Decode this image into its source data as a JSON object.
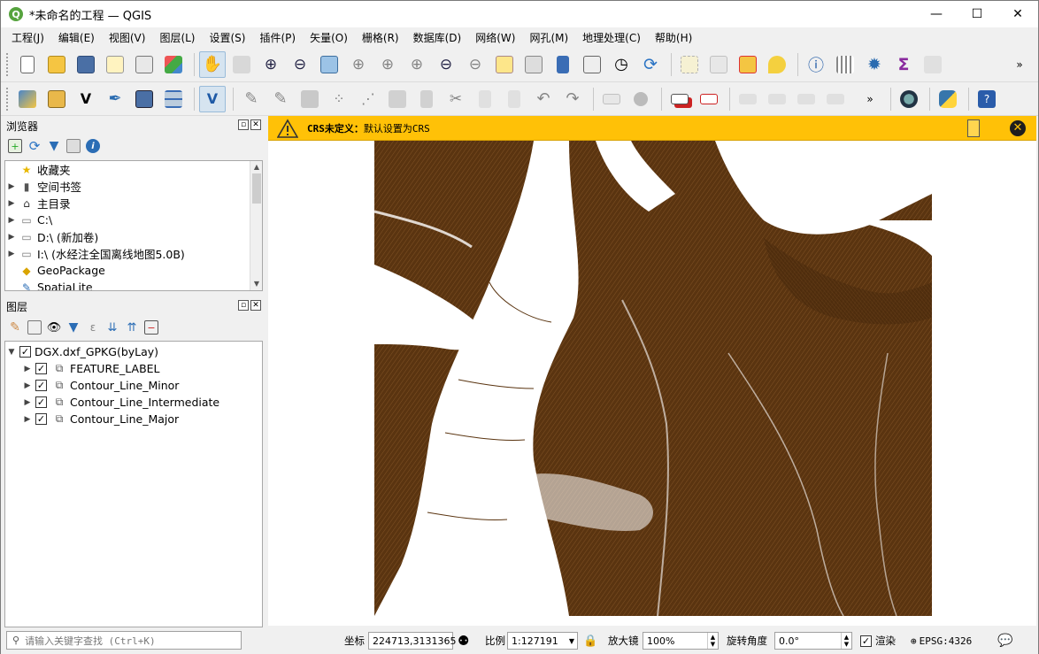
{
  "window": {
    "title": "*未命名的工程 — QGIS",
    "controls": [
      "—",
      "☐",
      "✕"
    ]
  },
  "menu": [
    "工程(J)",
    "编辑(E)",
    "视图(V)",
    "图层(L)",
    "设置(S)",
    "插件(P)",
    "矢量(O)",
    "栅格(R)",
    "数据库(D)",
    "网络(W)",
    "网孔(M)",
    "地理处理(C)",
    "帮助(H)"
  ],
  "browser": {
    "title": "浏览器",
    "items": [
      {
        "label": "收藏夹",
        "icon": "star-icon",
        "expand": false
      },
      {
        "label": "空间书签",
        "icon": "bookmark-icon",
        "expand": true
      },
      {
        "label": "主目录",
        "icon": "home-icon",
        "expand": true
      },
      {
        "label": "C:\\",
        "icon": "folder-icon",
        "expand": true
      },
      {
        "label": "D:\\ (新加卷)",
        "icon": "folder-icon",
        "expand": true
      },
      {
        "label": "I:\\ (水经注全国离线地图5.0B)",
        "icon": "folder-icon",
        "expand": true
      },
      {
        "label": "GeoPackage",
        "icon": "geopackage-icon",
        "expand": false
      },
      {
        "label": "SpatiaLite",
        "icon": "spatialite-icon",
        "expand": false
      }
    ]
  },
  "layers": {
    "title": "图层",
    "group": {
      "label": "DGX.dxf_GPKG(byLay)",
      "checked": true
    },
    "items": [
      {
        "label": "FEATURE_LABEL",
        "checked": true
      },
      {
        "label": "Contour_Line_Minor",
        "checked": true
      },
      {
        "label": "Contour_Line_Intermediate",
        "checked": true
      },
      {
        "label": "Contour_Line_Major",
        "checked": true
      }
    ]
  },
  "warning": {
    "bold": "CRS未定义：",
    "text": "默认设置为CRS"
  },
  "status": {
    "search_placeholder": "请输入关键字查找 (Ctrl+K)",
    "coord_label": "坐标",
    "coord_value": "224713,3131365",
    "scale_label": "比例",
    "scale_value": "1:127191",
    "magnifier_label": "放大镜",
    "magnifier_value": "100%",
    "rotation_label": "旋转角度",
    "rotation_value": "0.0°",
    "render_label": "渲染",
    "render_checked": true,
    "crs_label": "EPSG:4326"
  },
  "colors": {
    "contour": "#5a3410",
    "warning_bg": "#ffc107",
    "accent": "#589632"
  }
}
